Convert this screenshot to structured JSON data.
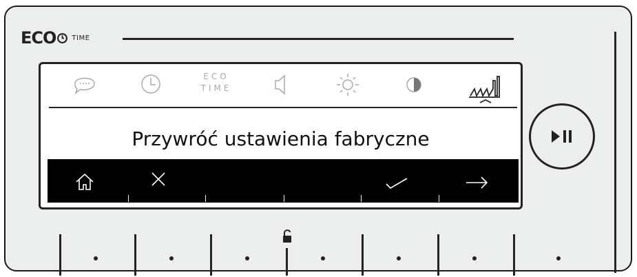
{
  "brand": {
    "logo_text": "ECO",
    "logo_suffix": "TIME",
    "clock_icon": "clock-icon"
  },
  "lcd": {
    "menu_icons": [
      {
        "name": "chat-bubble-icon"
      },
      {
        "name": "clock-icon"
      },
      {
        "name": "eco-time-icon",
        "line1": "ECO",
        "line2": "TIME"
      },
      {
        "name": "speaker-icon"
      },
      {
        "name": "sun-icon"
      },
      {
        "name": "contrast-icon"
      },
      {
        "name": "factory-icon",
        "selected": true
      }
    ],
    "title": "Przywróć ustawienia fabryczne",
    "softkeys": [
      {
        "name": "home-icon"
      },
      {
        "name": "close-icon"
      },
      {
        "name": "empty"
      },
      {
        "name": "empty"
      },
      {
        "name": "check-icon"
      },
      {
        "name": "arrow-right-icon"
      }
    ]
  },
  "controls": {
    "play_pause_icon": "play-pause-icon",
    "lock_icon": "unlocked-padlock-icon"
  },
  "colors": {
    "panel": "#eceeee",
    "lcd_bg": "#ffffff",
    "softbar": "#000000",
    "inactive_icon": "#aaaaaa",
    "ink": "#222222"
  }
}
